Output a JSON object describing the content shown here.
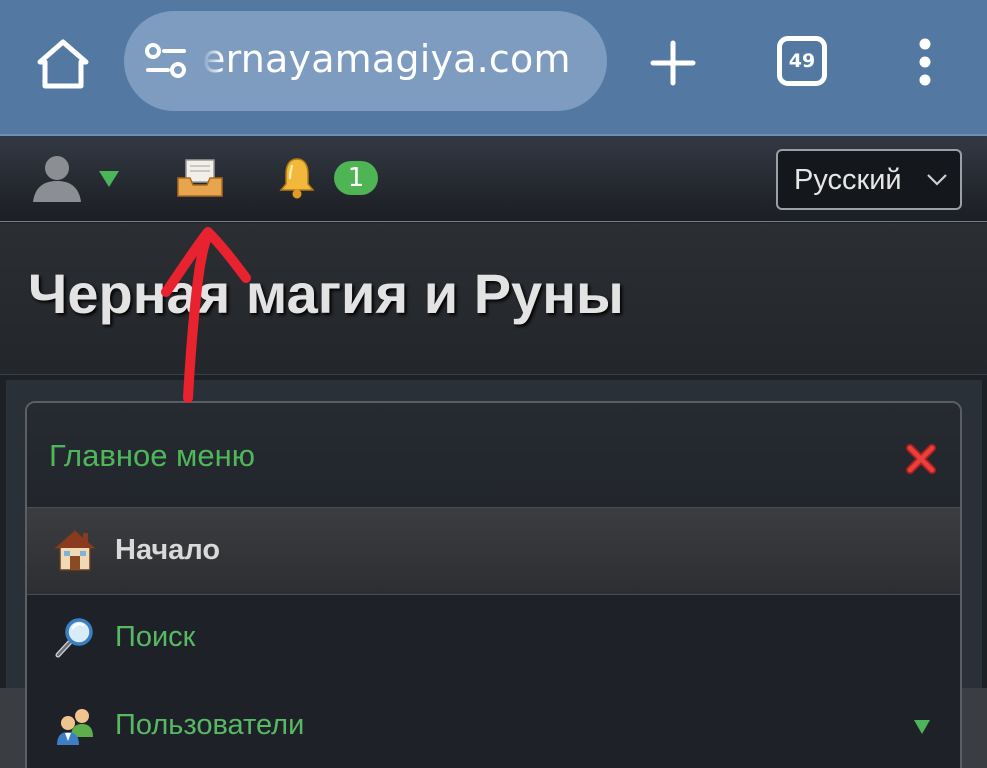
{
  "browser": {
    "url": "ernayamagiya.com",
    "tab_count": "49",
    "icons": [
      "home-icon",
      "site-settings-icon",
      "new-tab-icon",
      "tabs-icon",
      "more-menu-icon"
    ],
    "toolbar_color": "#5379a2",
    "url_pill_color": "#7d9cbf"
  },
  "site_toolbar": {
    "icons": [
      "user-avatar-icon",
      "dropdown-caret-icon",
      "inbox-icon",
      "bell-icon"
    ],
    "notification_count": "1",
    "language": "Русский",
    "badge_color": "#4fb454"
  },
  "header": {
    "title": "Черная магия и Руны"
  },
  "menu": {
    "title": "Главное меню",
    "items": [
      {
        "label": "Начало",
        "icon": "house-icon",
        "active": true
      },
      {
        "label": "Поиск",
        "icon": "magnifier-icon",
        "active": false
      },
      {
        "label": "Пользователи",
        "icon": "users-icon",
        "active": false
      }
    ],
    "accent_color": "#4db75a"
  },
  "annotation": {
    "type": "red-hand-drawn-arrow",
    "color": "#e8232f"
  }
}
